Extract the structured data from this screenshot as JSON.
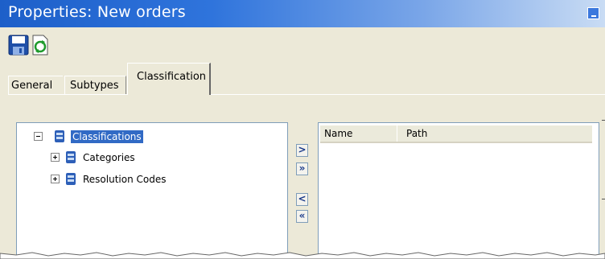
{
  "window": {
    "title": "Properties: New orders"
  },
  "toolbar": {
    "buttons": [
      {
        "icon": "save-icon"
      },
      {
        "icon": "refresh-icon"
      }
    ]
  },
  "tabs": [
    {
      "label": "General",
      "active": false
    },
    {
      "label": "Subtypes",
      "active": false
    },
    {
      "label": "Classification",
      "active": true
    }
  ],
  "tree": {
    "root": {
      "label": "Classifications",
      "expanded": true,
      "selected": true
    },
    "children": [
      {
        "label": "Categories",
        "expanded": false
      },
      {
        "label": "Resolution Codes",
        "expanded": false
      }
    ]
  },
  "transfer_buttons": [
    {
      "label": ">",
      "action": "add"
    },
    {
      "label": "»",
      "action": "add-all"
    },
    {
      "label": "<",
      "action": "remove"
    },
    {
      "label": "«",
      "action": "remove-all"
    }
  ],
  "list": {
    "columns": [
      "Name",
      "Path"
    ],
    "rows": []
  },
  "colors": {
    "titlebar": "#2f74dc",
    "selection": "#316ac5",
    "dialog_bg": "#ece9d8"
  }
}
